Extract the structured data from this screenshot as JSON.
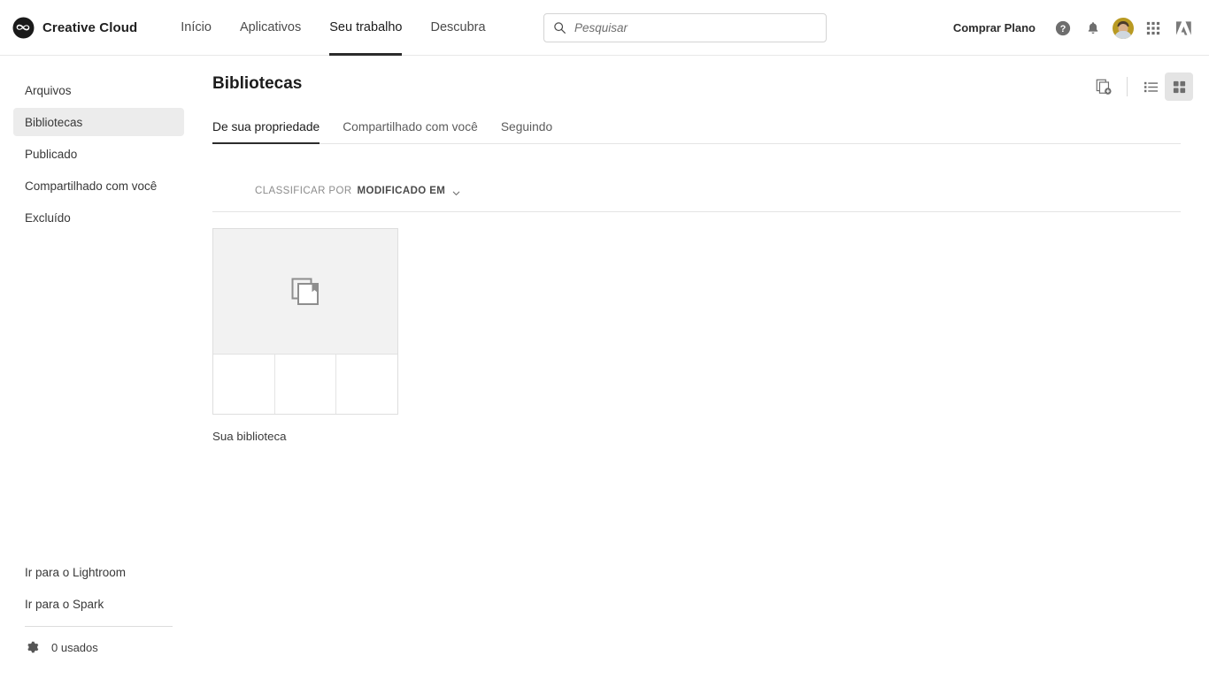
{
  "header": {
    "brand_name": "Creative Cloud",
    "logo_icon": "creative-cloud-logo",
    "nav": [
      {
        "label": "Início",
        "active": false
      },
      {
        "label": "Aplicativos",
        "active": false
      },
      {
        "label": "Seu trabalho",
        "active": true
      },
      {
        "label": "Descubra",
        "active": false
      }
    ],
    "search": {
      "placeholder": "Pesquisar",
      "value": "",
      "icon": "search-icon"
    },
    "buy_plan_label": "Comprar Plano",
    "icons": [
      {
        "name": "help-icon",
        "glyph": "?"
      },
      {
        "name": "notifications-bell-icon"
      },
      {
        "name": "user-avatar"
      },
      {
        "name": "app-grid-icon"
      },
      {
        "name": "adobe-logo-icon"
      }
    ]
  },
  "sidebar": {
    "items": [
      {
        "label": "Arquivos",
        "selected": false
      },
      {
        "label": "Bibliotecas",
        "selected": true
      },
      {
        "label": "Publicado",
        "selected": false
      },
      {
        "label": "Compartilhado com você",
        "selected": false
      },
      {
        "label": "Excluído",
        "selected": false
      }
    ],
    "links": [
      {
        "label": "Ir para o Lightroom"
      },
      {
        "label": "Ir para o Spark"
      }
    ],
    "usage": {
      "icon": "gear-icon",
      "label": "0 usados"
    }
  },
  "main": {
    "title": "Bibliotecas",
    "tools": [
      {
        "name": "create-new-library-icon",
        "active": false
      },
      {
        "name": "list-view-icon",
        "active": false
      },
      {
        "name": "grid-view-icon",
        "active": true
      }
    ],
    "tabs": [
      {
        "label": "De sua propriedade",
        "active": true
      },
      {
        "label": "Compartilhado com você",
        "active": false
      },
      {
        "label": "Seguindo",
        "active": false
      }
    ],
    "sort": {
      "label": "CLASSIFICAR POR",
      "value": "MODIFICADO EM",
      "chevron": "chevron-down-icon"
    },
    "libraries": [
      {
        "name": "Sua biblioteca",
        "icon": "library-icon",
        "empty_cells": 3
      }
    ]
  },
  "colors": {
    "accent": "#2c2c2c",
    "selected_bg": "#ececec",
    "thumb_bg": "#f2f2f2",
    "border": "#e4e4e4"
  }
}
